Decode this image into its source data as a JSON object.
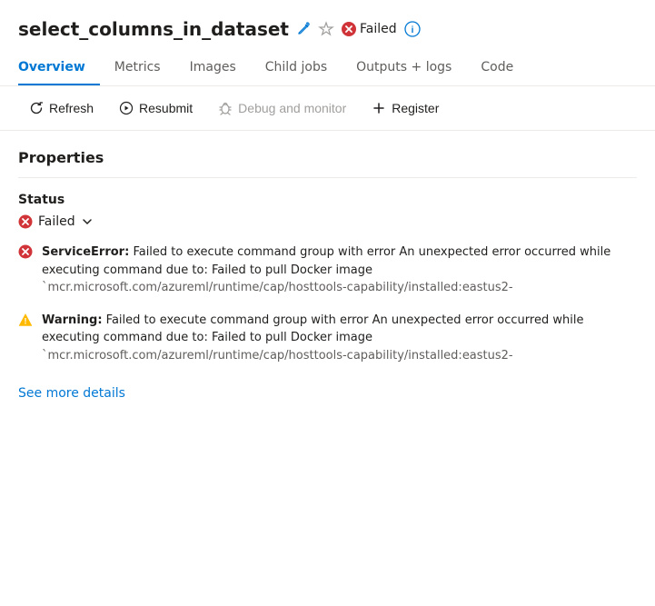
{
  "header": {
    "title": "select_columns_in_dataset",
    "status": "Failed",
    "editIcon": "edit-icon",
    "starIcon": "star-icon",
    "infoIcon": "info-icon"
  },
  "tabs": [
    {
      "id": "overview",
      "label": "Overview",
      "active": true
    },
    {
      "id": "metrics",
      "label": "Metrics",
      "active": false
    },
    {
      "id": "images",
      "label": "Images",
      "active": false
    },
    {
      "id": "child-jobs",
      "label": "Child jobs",
      "active": false
    },
    {
      "id": "outputs-logs",
      "label": "Outputs + logs",
      "active": false
    },
    {
      "id": "code",
      "label": "Code",
      "active": false
    }
  ],
  "toolbar": {
    "refresh_label": "Refresh",
    "resubmit_label": "Resubmit",
    "debug_label": "Debug and monitor",
    "register_label": "Register"
  },
  "content": {
    "section_title": "Properties",
    "status_label": "Status",
    "status_value": "Failed",
    "chevron_label": "expand status",
    "error_message": "ServiceError: Failed to execute command group with error An unexpected error occurred while executing command due to: Failed to pull Docker image `mcr.microsoft.com/azureml/runtime/cap/hosttools-capability/installed:eastus2-",
    "warning_message": "Warning: Failed to execute command group with error An unexpected error occurred while executing command due to: Failed to pull Docker image `mcr.microsoft.com/azureml/runtime/cap/hosttools-capability/installed:eastus2-",
    "see_more_label": "See more details"
  }
}
